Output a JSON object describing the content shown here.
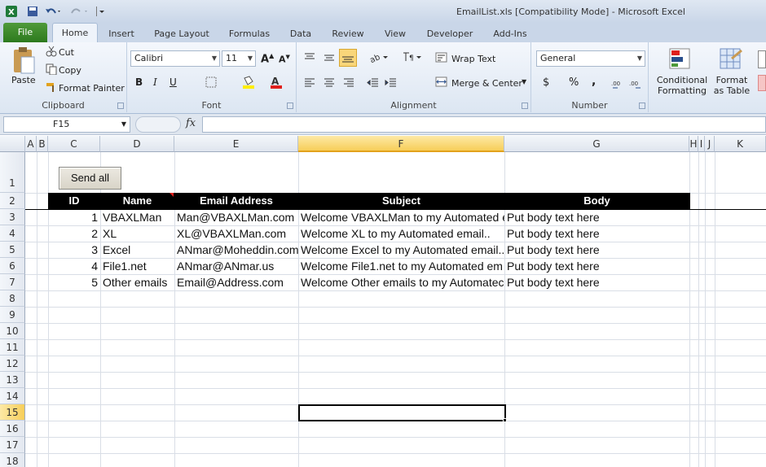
{
  "window": {
    "title": "EmailList.xls  [Compatibility Mode]  -  Microsoft Excel"
  },
  "tabs": [
    "File",
    "Home",
    "Insert",
    "Page Layout",
    "Formulas",
    "Data",
    "Review",
    "View",
    "Developer",
    "Add-Ins"
  ],
  "ribbon": {
    "clipboard": {
      "label": "Clipboard",
      "paste": "Paste",
      "cut": "Cut",
      "copy": "Copy",
      "format_painter": "Format Painter"
    },
    "font": {
      "label": "Font",
      "name": "Calibri",
      "size": "11"
    },
    "alignment": {
      "label": "Alignment",
      "wrap_text": "Wrap Text",
      "merge_center": "Merge & Center"
    },
    "number": {
      "label": "Number",
      "format": "General",
      "currency": "$",
      "percent": "%",
      "comma": ","
    },
    "styles": {
      "conditional_formatting": "Conditional Formatting",
      "format_as_table": "Format as Table"
    }
  },
  "formula_bar": {
    "name_box": "F15",
    "fx": "fx",
    "content": ""
  },
  "grid": {
    "columns": [
      "A",
      "B",
      "C",
      "D",
      "E",
      "F",
      "G",
      "H",
      "I",
      "J",
      "K"
    ],
    "selected_column": "F",
    "rows": [
      "1",
      "2",
      "3",
      "4",
      "5",
      "6",
      "7",
      "8",
      "9",
      "10",
      "11",
      "12",
      "13",
      "14",
      "15",
      "16",
      "17",
      "18"
    ],
    "selected_row": "15",
    "button": "Send all",
    "headers": {
      "id": "ID",
      "name": "Name",
      "email": "Email Address",
      "subject": "Subject",
      "body": "Body"
    },
    "records": [
      {
        "id": "1",
        "name": "VBAXLMan",
        "email": "Man@VBAXLMan.com",
        "subject": "Welcome VBAXLMan to my Automated e",
        "body": "Put body text here"
      },
      {
        "id": "2",
        "name": "XL",
        "email": "XL@VBAXLMan.com",
        "subject": "Welcome XL to my Automated email..",
        "body": "Put body text here"
      },
      {
        "id": "3",
        "name": "Excel",
        "email": "ANmar@Moheddin.com",
        "subject": "Welcome Excel to my Automated email..",
        "body": "Put body text here"
      },
      {
        "id": "4",
        "name": "File1.net",
        "email": "ANmar@ANmar.us",
        "subject": "Welcome File1.net to my Automated em",
        "body": "Put body text here"
      },
      {
        "id": "5",
        "name": "Other emails",
        "email": "Email@Address.com",
        "subject": "Welcome Other emails to my Automatec",
        "body": "Put body text here"
      }
    ]
  }
}
